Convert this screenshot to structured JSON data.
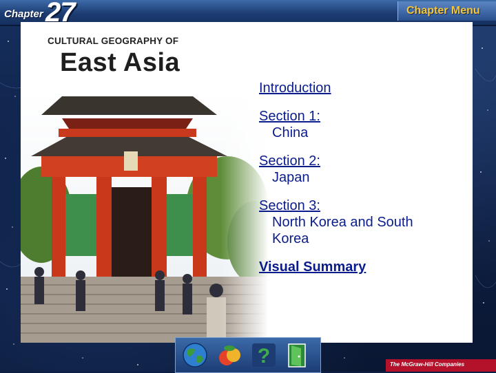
{
  "header": {
    "chapter_word": "Chapter",
    "chapter_number": "27",
    "menu_button_label": "Chapter Menu",
    "accent_color": "#f3c63c"
  },
  "title": {
    "line1": "CULTURAL GEOGRAPHY OF",
    "line2": "East Asia"
  },
  "menu": {
    "link_color": "#0a1c8c",
    "items": [
      {
        "label": "Introduction"
      },
      {
        "label": "Section 1:",
        "sub": "China"
      },
      {
        "label": "Section 2:",
        "sub": "Japan"
      },
      {
        "label": "Section 3:",
        "sub": "North Korea and South Korea"
      },
      {
        "label": "Visual Summary"
      }
    ]
  },
  "nav": {
    "buttons": [
      "globe-icon",
      "fruit-icon",
      "help-icon",
      "exit-door-icon"
    ]
  },
  "footer": {
    "publisher": "The McGraw-Hill Companies",
    "publisher_color": "#b3122a"
  }
}
